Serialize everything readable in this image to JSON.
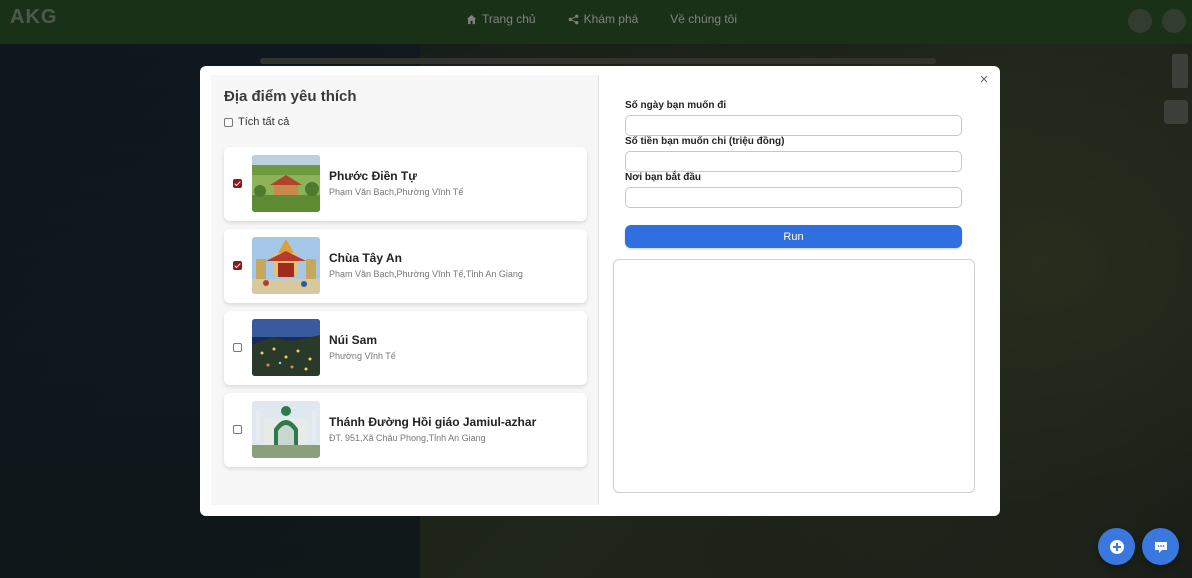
{
  "app": {
    "logo": "AKG"
  },
  "nav": [
    {
      "label": "Trang chủ",
      "icon": "home-icon"
    },
    {
      "label": "Khám phá",
      "icon": "share-icon"
    },
    {
      "label": "Về chúng tôi",
      "icon": ""
    }
  ],
  "modal": {
    "close_symbol": "×",
    "favorites": {
      "title": "Địa điểm yêu thích",
      "check_all_label": "Tích tất cả",
      "check_all_checked": false,
      "items": [
        {
          "name": "Phước Điền Tự",
          "address": "Phạm Văn Bạch,Phường Vĩnh Tế",
          "checked": true,
          "image": "pagoda-garden-photo"
        },
        {
          "name": "Chùa Tây An",
          "address": "Phạm Văn Bạch,Phường Vĩnh Tế,Tỉnh An Giang",
          "checked": true,
          "image": "temple-photo"
        },
        {
          "name": "Núi Sam",
          "address": "Phường Vĩnh Tế",
          "checked": false,
          "image": "night-city-photo"
        },
        {
          "name": "Thánh Đường Hồi giáo Jamiul-azhar",
          "address": "ĐT. 951,Xã Châu Phong,Tỉnh An Giang",
          "checked": false,
          "image": "mosque-photo"
        }
      ]
    },
    "form": {
      "days_label": "Số ngày bạn muốn đi",
      "days_value": "",
      "budget_label": "Số tiền bạn muốn chi (triệu đồng)",
      "budget_value": "",
      "start_label": "Nơi bạn bắt đầu",
      "start_value": "",
      "run_label": "Run",
      "result_text": ""
    }
  },
  "floating": [
    {
      "icon": "plus-circle-icon"
    },
    {
      "icon": "chat-icon"
    }
  ],
  "colors": {
    "topbar": "#2f5a2a",
    "run_button": "#2f6fe0",
    "checkbox_checked": "#8b1a1a",
    "fab": "#3a78e0"
  }
}
